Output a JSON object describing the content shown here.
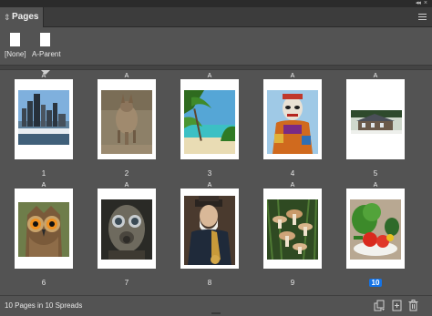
{
  "panel": {
    "title": "Pages",
    "grip_glyph": "⇕",
    "collapse_glyph": "◂◂",
    "close_glyph": "×"
  },
  "parents": [
    {
      "label": "[None]"
    },
    {
      "label": "A-Parent"
    }
  ],
  "pages": [
    {
      "number": "1",
      "master": "A",
      "image": "city-skyline"
    },
    {
      "number": "2",
      "master": "A",
      "image": "armadillo"
    },
    {
      "number": "3",
      "master": "A",
      "image": "tropical-beach"
    },
    {
      "number": "4",
      "master": "A",
      "image": "masked-figure"
    },
    {
      "number": "5",
      "master": "A",
      "image": "house"
    },
    {
      "number": "6",
      "master": "A",
      "image": "owl"
    },
    {
      "number": "7",
      "master": "A",
      "image": "gas-mask"
    },
    {
      "number": "8",
      "master": "A",
      "image": "saxophone-player"
    },
    {
      "number": "9",
      "master": "A",
      "image": "mushrooms"
    },
    {
      "number": "10",
      "master": "A",
      "image": "vegetables",
      "selected": true
    }
  ],
  "status": {
    "text": "10 Pages in 10 Spreads"
  },
  "icons": {
    "edit_page_size": "edit-page-size-icon",
    "new_page": "new-page-icon",
    "delete": "trash-icon"
  },
  "colors": {
    "panel_bg": "#535353",
    "selection": "#1473e6"
  }
}
